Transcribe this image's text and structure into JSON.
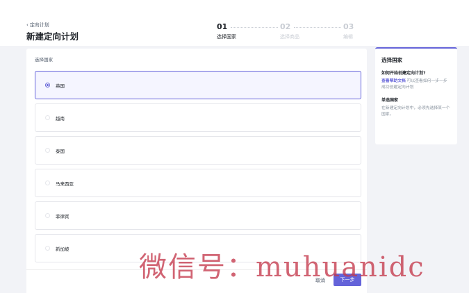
{
  "header": {
    "back_label": "定向计划",
    "title": "新建定向计划"
  },
  "steps": [
    {
      "num": "01",
      "label": "选择国家",
      "state": "active"
    },
    {
      "num": "02",
      "label": "选择商品",
      "state": "inactive"
    },
    {
      "num": "03",
      "label": "编辑",
      "state": "inactive"
    }
  ],
  "main": {
    "section_label": "选择国家",
    "options": [
      {
        "label": "英国",
        "selected": true
      },
      {
        "label": "越南",
        "selected": false
      },
      {
        "label": "泰国",
        "selected": false
      },
      {
        "label": "马来西亚",
        "selected": false
      },
      {
        "label": "菲律宾",
        "selected": false
      },
      {
        "label": "新加坡",
        "selected": false
      }
    ]
  },
  "footer": {
    "cancel_label": "取消",
    "next_label": "下一步"
  },
  "help": {
    "title": "选择国家",
    "q1": "如何开始创建定向计划?",
    "q1_link": "查看帮助文档",
    "q1_text": "可以查看如何一步一步成功创建定向计划",
    "q2": "单选国家",
    "q2_text": "在新建定向计划中，必须先选择某一个国家。"
  },
  "colors": {
    "accent": "#6463d9",
    "watermark": "#c4384c"
  },
  "watermark": "微信号：muhuanidc"
}
